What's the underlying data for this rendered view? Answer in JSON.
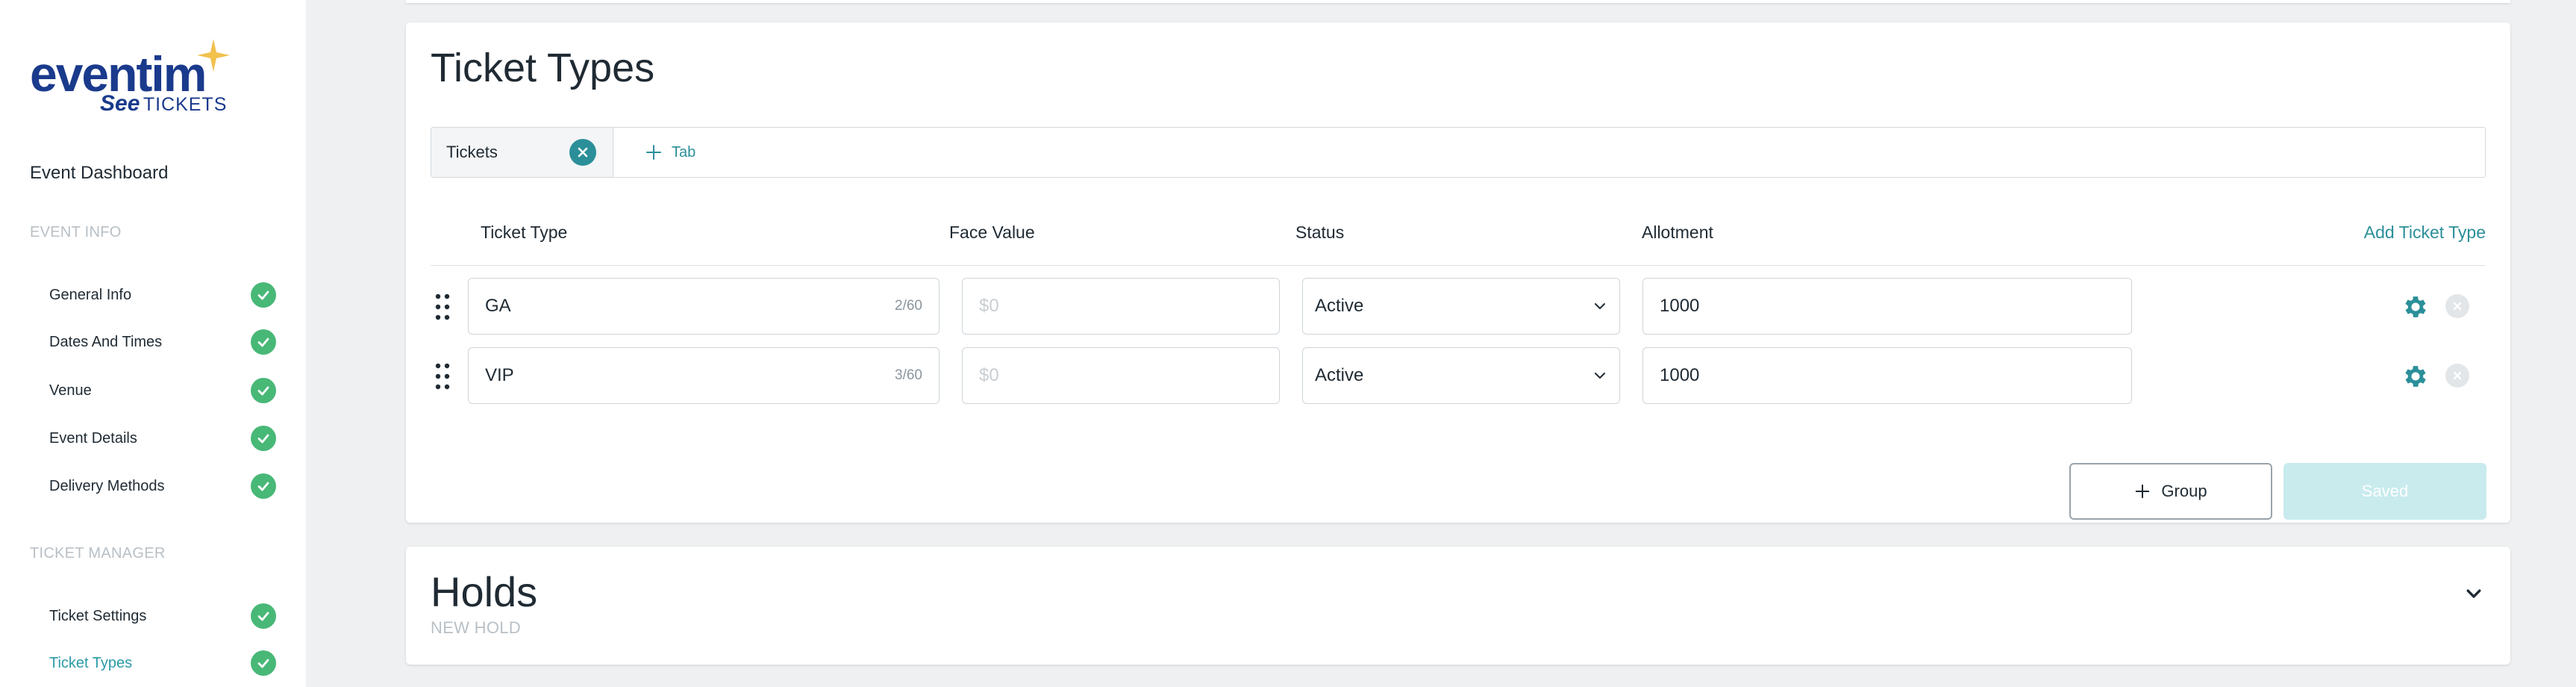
{
  "logo": {
    "brand": "eventim",
    "sub_see": "See",
    "sub_tickets": "TICKETS"
  },
  "sidebar": {
    "title": "Event Dashboard",
    "event_info_label": "EVENT INFO",
    "event_info_items": [
      {
        "label": "General Info"
      },
      {
        "label": "Dates And Times"
      },
      {
        "label": "Venue"
      },
      {
        "label": "Event Details"
      },
      {
        "label": "Delivery Methods"
      }
    ],
    "ticket_manager_label": "TICKET MANAGER",
    "ticket_manager_items": [
      {
        "label": "Ticket Settings"
      },
      {
        "label": "Ticket Types"
      }
    ]
  },
  "ticket_types": {
    "title": "Ticket Types",
    "tab": {
      "label": "Tickets"
    },
    "add_tab_label": "Tab",
    "columns": {
      "ticket_type": "Ticket Type",
      "face_value": "Face Value",
      "status": "Status",
      "allotment": "Allotment"
    },
    "add_ticket_type_label": "Add Ticket Type",
    "rows": [
      {
        "name": "GA",
        "counter": "2/60",
        "face_value_placeholder": "$0",
        "status": "Active",
        "allotment": "1000"
      },
      {
        "name": "VIP",
        "counter": "3/60",
        "face_value_placeholder": "$0",
        "status": "Active",
        "allotment": "1000"
      }
    ],
    "group_button_label": "Group",
    "saved_button_label": "Saved"
  },
  "holds": {
    "title": "Holds",
    "new_hold_label": "NEW HOLD"
  },
  "colors": {
    "accent": "#2b8f99",
    "success": "#48b877",
    "brand": "#1a3a8c",
    "star": "#f2c14e"
  }
}
